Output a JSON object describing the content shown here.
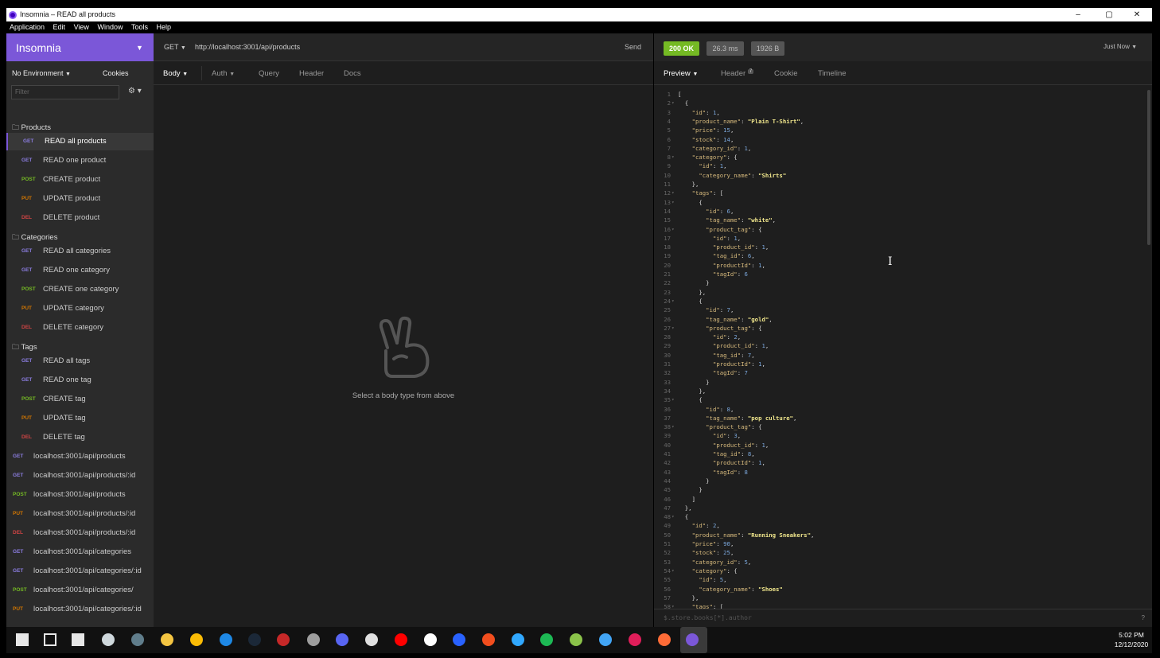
{
  "window": {
    "title": "Insomnia – READ all products",
    "controls": [
      "–",
      "▢",
      "✕"
    ]
  },
  "menu": [
    "Application",
    "Edit",
    "View",
    "Window",
    "Tools",
    "Help"
  ],
  "workspace": "Insomnia",
  "environment": "No Environment",
  "cookies": "Cookies",
  "filter_placeholder": "Filter",
  "request": {
    "method": "GET",
    "url": "http://localhost:3001/api/products",
    "send": "Send"
  },
  "response": {
    "status": "200 OK",
    "time": "26.3 ms",
    "size": "1926 B",
    "when": "Just Now"
  },
  "request_tabs": [
    "Body",
    "Auth",
    "Query",
    "Header",
    "Docs"
  ],
  "empty_message": "Select a body type from above",
  "response_tabs": {
    "preview": "Preview",
    "header": "Header",
    "header_count": "7",
    "cookie": "Cookie",
    "timeline": "Timeline"
  },
  "response_filter_placeholder": "$.store.books[*].author",
  "help": "?",
  "folders": [
    {
      "name": "Products",
      "items": [
        {
          "method": "GET",
          "name": "READ all products"
        },
        {
          "method": "GET",
          "name": "READ one product"
        },
        {
          "method": "POST",
          "name": "CREATE product"
        },
        {
          "method": "PUT",
          "name": "UPDATE product"
        },
        {
          "method": "DEL",
          "name": "DELETE product"
        }
      ]
    },
    {
      "name": "Categories",
      "items": [
        {
          "method": "GET",
          "name": "READ all categories"
        },
        {
          "method": "GET",
          "name": "READ one category"
        },
        {
          "method": "POST",
          "name": "CREATE one category"
        },
        {
          "method": "PUT",
          "name": "UPDATE category"
        },
        {
          "method": "DEL",
          "name": "DELETE category"
        }
      ]
    },
    {
      "name": "Tags",
      "items": [
        {
          "method": "GET",
          "name": "READ all tags"
        },
        {
          "method": "GET",
          "name": "READ one tag"
        },
        {
          "method": "POST",
          "name": "CREATE tag"
        },
        {
          "method": "PUT",
          "name": "UPDATE tag"
        },
        {
          "method": "DEL",
          "name": "DELETE tag"
        }
      ]
    }
  ],
  "root_requests": [
    {
      "method": "GET",
      "name": "localhost:3001/api/products"
    },
    {
      "method": "GET",
      "name": "localhost:3001/api/products/:id"
    },
    {
      "method": "POST",
      "name": "localhost:3001/api/products"
    },
    {
      "method": "PUT",
      "name": "localhost:3001/api/products/:id"
    },
    {
      "method": "DEL",
      "name": "localhost:3001/api/products/:id"
    },
    {
      "method": "GET",
      "name": "localhost:3001/api/categories"
    },
    {
      "method": "GET",
      "name": "localhost:3001/api/categories/:id"
    },
    {
      "method": "POST",
      "name": "localhost:3001/api/categories/"
    },
    {
      "method": "PUT",
      "name": "localhost:3001/api/categories/:id"
    }
  ],
  "code_lines": [
    "[",
    "  {",
    "    \"id\": 1,",
    "    \"product_name\": \"Plain T-Shirt\",",
    "    \"price\": 15,",
    "    \"stock\": 14,",
    "    \"category_id\": 1,",
    "    \"category\": {",
    "      \"id\": 1,",
    "      \"category_name\": \"Shirts\"",
    "    },",
    "    \"tags\": [",
    "      {",
    "        \"id\": 6,",
    "        \"tag_name\": \"white\",",
    "        \"product_tag\": {",
    "          \"id\": 1,",
    "          \"product_id\": 1,",
    "          \"tag_id\": 6,",
    "          \"productId\": 1,",
    "          \"tagId\": 6",
    "        }",
    "      },",
    "      {",
    "        \"id\": 7,",
    "        \"tag_name\": \"gold\",",
    "        \"product_tag\": {",
    "          \"id\": 2,",
    "          \"product_id\": 1,",
    "          \"tag_id\": 7,",
    "          \"productId\": 1,",
    "          \"tagId\": 7",
    "        }",
    "      },",
    "      {",
    "        \"id\": 8,",
    "        \"tag_name\": \"pop culture\",",
    "        \"product_tag\": {",
    "          \"id\": 3,",
    "          \"product_id\": 1,",
    "          \"tag_id\": 8,",
    "          \"productId\": 1,",
    "          \"tagId\": 8",
    "        }",
    "      }",
    "    ]",
    "  },",
    "  {",
    "    \"id\": 2,",
    "    \"product_name\": \"Running Sneakers\",",
    "    \"price\": 90,",
    "    \"stock\": 25,",
    "    \"category_id\": 5,",
    "    \"category\": {",
    "      \"id\": 5,",
    "      \"category_name\": \"Shoes\"",
    "    },",
    "    \"tags\": ["
  ],
  "fold_lines": [
    2,
    8,
    12,
    13,
    16,
    24,
    27,
    35,
    38,
    48,
    54,
    58
  ],
  "taskbar": {
    "apps": [
      {
        "name": "start-icon",
        "color": "#ffffff"
      },
      {
        "name": "search-icon",
        "color": "#ffffff"
      },
      {
        "name": "task-view-icon",
        "color": "#ffffff"
      },
      {
        "name": "browser-icon",
        "color": "#cfd8dc"
      },
      {
        "name": "calculator-icon",
        "color": "#607d8b"
      },
      {
        "name": "file-explorer-icon",
        "color": "#f4c542"
      },
      {
        "name": "chrome-icon",
        "color": "#fbbc05"
      },
      {
        "name": "vscode-icon",
        "color": "#1e88e5"
      },
      {
        "name": "steam-icon",
        "color": "#1b2838"
      },
      {
        "name": "game-icon",
        "color": "#c62828"
      },
      {
        "name": "tool-icon",
        "color": "#9e9e9e"
      },
      {
        "name": "discord-icon",
        "color": "#5865f2"
      },
      {
        "name": "app-icon",
        "color": "#e0e0e0"
      },
      {
        "name": "youtube-icon",
        "color": "#ff0000"
      },
      {
        "name": "github-icon",
        "color": "#ffffff"
      },
      {
        "name": "ghost-icon",
        "color": "#2962ff"
      },
      {
        "name": "figma-icon",
        "color": "#f24e1e"
      },
      {
        "name": "photoshop-icon",
        "color": "#31a8ff"
      },
      {
        "name": "spotify-icon",
        "color": "#1db954"
      },
      {
        "name": "notepad-icon",
        "color": "#8bc34a"
      },
      {
        "name": "terminal-icon",
        "color": "#42a5f5"
      },
      {
        "name": "slack-icon",
        "color": "#e01e5a"
      },
      {
        "name": "postman-icon",
        "color": "#ff6c37"
      },
      {
        "name": "insomnia-icon",
        "color": "#7b57d8"
      }
    ],
    "time": "5:02 PM",
    "date": "12/12/2020"
  }
}
